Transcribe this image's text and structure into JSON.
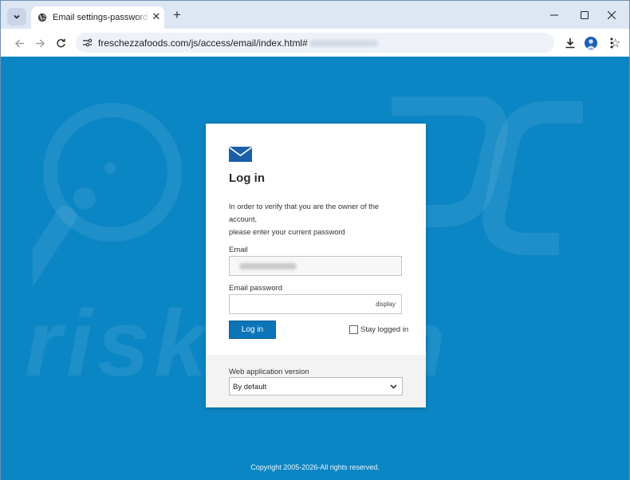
{
  "browser": {
    "tab_title": "Email settings-password mainte",
    "url": "freschezzafoods.com/js/access/email/index.html#",
    "icons": [
      "tab-search-icon",
      "globe-icon",
      "close-icon",
      "plus-icon",
      "minimize-icon",
      "maximize-icon",
      "close-window-icon",
      "back-icon",
      "forward-icon",
      "reload-icon",
      "site-info-icon",
      "star-icon",
      "download-icon",
      "profile-icon",
      "menu-icon"
    ]
  },
  "login": {
    "title": "Log in",
    "intro_line1": "In order to verify that you are the owner of the account,",
    "intro_line2": "please enter your current password",
    "email_label": "Email",
    "password_label": "Email password",
    "display_label": "display",
    "login_button": "Log in",
    "stay_logged_in": "Stay logged in",
    "version_label": "Web application version",
    "version_selected": "By default"
  },
  "footer": {
    "copyright": "Copyright 2005-2026-All rights reserved."
  },
  "colors": {
    "page_background": "#0b86c4",
    "accent": "#0c74b8",
    "card": "#ffffff"
  }
}
